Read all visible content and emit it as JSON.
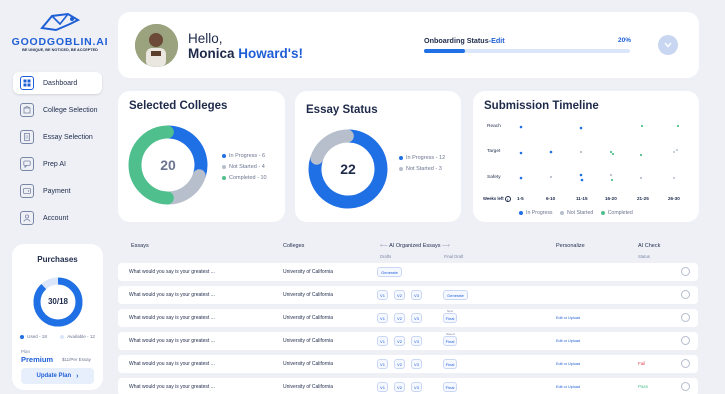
{
  "brand": {
    "name": "GOODGOBLIN.AI",
    "tagline": "BE UNIQUE, BE NOTICED, BE ACCEPTED"
  },
  "sidebar": {
    "items": [
      {
        "label": "Dashboard",
        "icon": "dashboard-icon"
      },
      {
        "label": "College Selection",
        "icon": "building-icon"
      },
      {
        "label": "Essay Selection",
        "icon": "essay-icon"
      },
      {
        "label": "Prep AI",
        "icon": "chat-icon"
      },
      {
        "label": "Payment",
        "icon": "wallet-icon"
      },
      {
        "label": "Account",
        "icon": "user-icon"
      }
    ]
  },
  "purchases": {
    "title": "Purchases",
    "value": "30/18",
    "used_fraction": 0.88,
    "legend_used": "Used - 18",
    "legend_available": "Available - 12",
    "plan_label": "Plan",
    "plan_name": "Premium",
    "plan_price": "$11/Per Essay",
    "update_button": "Update Plan"
  },
  "header": {
    "greeting": "Hello,",
    "name_first": "Monica",
    "name_last": "Howard's!",
    "onboarding_label": "Onboarding Status",
    "onboarding_edit": "-Edit",
    "onboarding_percent": "20%",
    "onboarding_progress": 0.2
  },
  "selected_colleges": {
    "title": "Selected Colleges",
    "total": "20",
    "legend": [
      "In Progress - 6",
      "Not Started - 4",
      "Completed - 10"
    ],
    "values": [
      6,
      4,
      10
    ],
    "colors": [
      "#1f6fe5",
      "#b7bfcc",
      "#4fc08d"
    ]
  },
  "essay_status": {
    "title": "Essay Status",
    "total": "22",
    "legend": [
      "In Progress - 12",
      "Not Started - 3"
    ],
    "values": [
      12,
      3
    ],
    "colors": [
      "#1f6fe5",
      "#b7bfcc",
      "#4fc08d"
    ]
  },
  "submission_timeline": {
    "title": "Submission Timeline",
    "rows": [
      "Reach",
      "Target",
      "Safety"
    ],
    "x_label": "Weeks left",
    "columns": [
      "1-5",
      "6-10",
      "11-15",
      "16-20",
      "21-25",
      "26-30"
    ],
    "legend": [
      "In Progress",
      "Not Started",
      "Completed"
    ],
    "colors": [
      "#1f6fe5",
      "#b7bfcc",
      "#4fc08d"
    ]
  },
  "table": {
    "headers": {
      "essays": "Essays",
      "colleges": "Colleges",
      "organized": "AI Organized Essays",
      "drafts": "Drafts",
      "final_draft": "Final Draft",
      "personalize": "Personalize",
      "ai_check": "AI Check",
      "status": "Status"
    },
    "rows": [
      {
        "essay": "What would you say is your greatest ...",
        "college": "University of California",
        "drafts": [],
        "draft_action": "Generate",
        "final": "",
        "final_note": "",
        "personalize": "",
        "check": ""
      },
      {
        "essay": "What would you say is your greatest ...",
        "college": "University of California",
        "drafts": [
          "V1",
          "V2",
          "V3"
        ],
        "draft_action": "",
        "final": "Generate",
        "final_note": "",
        "personalize": "",
        "check": ""
      },
      {
        "essay": "What would you say is your greatest ...",
        "college": "University of California",
        "drafts": [
          "V1",
          "V2",
          "V3"
        ],
        "draft_action": "",
        "final": "Final",
        "final_note": "New",
        "personalize": "Edit or Upload",
        "check": ""
      },
      {
        "essay": "What would you say is your greatest ...",
        "college": "University of California",
        "drafts": [
          "V1",
          "V2",
          "V3"
        ],
        "draft_action": "",
        "final": "Final",
        "final_note": "Saved",
        "personalize": "Edit or Upload",
        "check": ""
      },
      {
        "essay": "What would you say is your greatest ...",
        "college": "University of California",
        "drafts": [
          "V1",
          "V2",
          "V3"
        ],
        "draft_action": "",
        "final": "Final",
        "final_note": "",
        "personalize": "Edit or Upload",
        "check": "Fail"
      },
      {
        "essay": "What would you say is your greatest ...",
        "college": "University of California",
        "drafts": [
          "V1",
          "V2",
          "V3"
        ],
        "draft_action": "",
        "final": "Final",
        "final_note": "",
        "personalize": "Edit or Upload",
        "check": "Pass"
      }
    ]
  }
}
